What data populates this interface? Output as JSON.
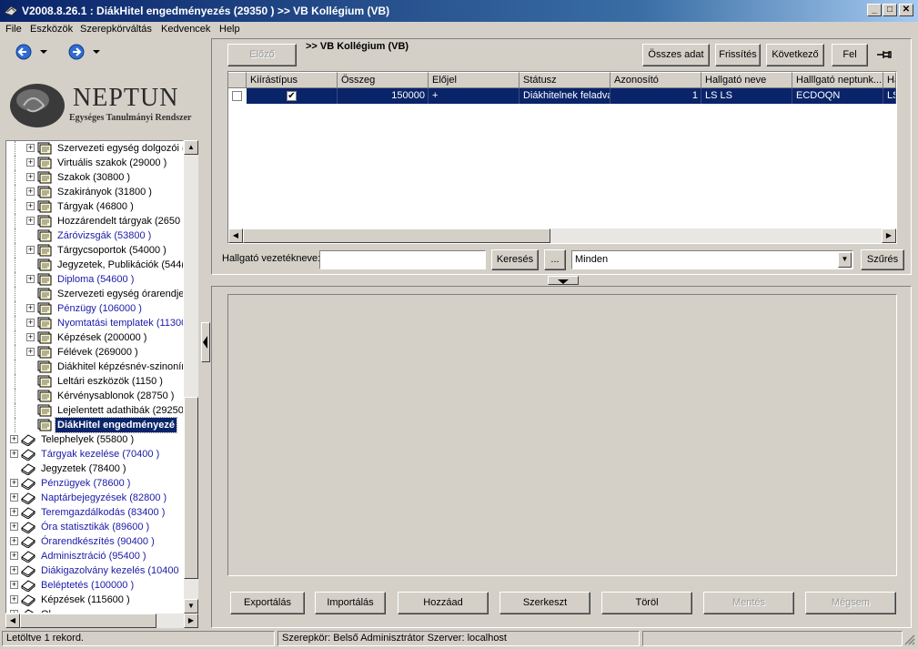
{
  "window": {
    "title": "V2008.8.26.1 : DiákHitel engedményezés (29350  )  >> VB Kollégium (VB)"
  },
  "menu": [
    "File",
    "Eszközök",
    "Szerepkörváltás",
    "Kedvencek",
    "Help"
  ],
  "logo": {
    "name": "NEPTUN",
    "subtitle": "Egységes Tanulmányi Rendszer"
  },
  "tree": [
    {
      "label": "Szervezeti egység dolgozói (",
      "blue": false,
      "level": 2,
      "exp": true
    },
    {
      "label": "Virtuális szakok (29000  )",
      "blue": false,
      "level": 2,
      "exp": true
    },
    {
      "label": "Szakok (30800  )",
      "blue": false,
      "level": 2,
      "exp": true
    },
    {
      "label": "Szakirányok (31800  )",
      "blue": false,
      "level": 2,
      "exp": true
    },
    {
      "label": "Tárgyak (46800  )",
      "blue": false,
      "level": 2,
      "exp": true
    },
    {
      "label": "Hozzárendelt tárgyak (2650",
      "blue": false,
      "level": 2,
      "exp": true
    },
    {
      "label": "Záróvizsgák (53800  )",
      "blue": true,
      "level": 2,
      "exp": false
    },
    {
      "label": "Tárgycsoportok (54000  )",
      "blue": false,
      "level": 2,
      "exp": true
    },
    {
      "label": "Jegyzetek, Publikációk (544(",
      "blue": false,
      "level": 2,
      "exp": false
    },
    {
      "label": "Diploma (54600  )",
      "blue": true,
      "level": 2,
      "exp": true
    },
    {
      "label": "Szervezeti egység órarendje",
      "blue": false,
      "level": 2,
      "exp": false
    },
    {
      "label": "Pénzügy (106000  )",
      "blue": true,
      "level": 2,
      "exp": true
    },
    {
      "label": "Nyomtatási templatek (11300",
      "blue": true,
      "level": 2,
      "exp": true
    },
    {
      "label": "Képzések (200000  )",
      "blue": false,
      "level": 2,
      "exp": true
    },
    {
      "label": "Félévek (269000  )",
      "blue": false,
      "level": 2,
      "exp": true
    },
    {
      "label": "Diákhitel képzésnév-szinoním",
      "blue": false,
      "level": 2,
      "exp": false
    },
    {
      "label": "Leltári eszközök (1150  )",
      "blue": false,
      "level": 2,
      "exp": false
    },
    {
      "label": "Kérvénysablonok (28750  )",
      "blue": false,
      "level": 2,
      "exp": false
    },
    {
      "label": "Lejelentett adathibák (29250",
      "blue": false,
      "level": 2,
      "exp": false
    },
    {
      "label": "DiákHitel engedményezé",
      "blue": false,
      "level": 2,
      "exp": false,
      "selected": true
    },
    {
      "label": "Telephelyek (55800  )",
      "blue": false,
      "level": 1,
      "exp": true
    },
    {
      "label": "Tárgyak kezelése (70400  )",
      "blue": true,
      "level": 1,
      "exp": true
    },
    {
      "label": "Jegyzetek (78400  )",
      "blue": false,
      "level": 1,
      "exp": false
    },
    {
      "label": "Pénzügyek (78600  )",
      "blue": true,
      "level": 1,
      "exp": true
    },
    {
      "label": "Naptárbejegyzések (82800  )",
      "blue": true,
      "level": 1,
      "exp": true
    },
    {
      "label": "Teremgazdálkodás (83400  )",
      "blue": true,
      "level": 1,
      "exp": true
    },
    {
      "label": "Óra statisztikák (89600  )",
      "blue": true,
      "level": 1,
      "exp": true
    },
    {
      "label": "Órarendkészítés (90400  )",
      "blue": true,
      "level": 1,
      "exp": true
    },
    {
      "label": "Adminisztráció (95400  )",
      "blue": true,
      "level": 1,
      "exp": true
    },
    {
      "label": "Diákigazolvány kezelés (10400",
      "blue": true,
      "level": 1,
      "exp": true
    },
    {
      "label": "Beléptetés (100000  )",
      "blue": true,
      "level": 1,
      "exp": true
    },
    {
      "label": "Képzések (115600  )",
      "blue": false,
      "level": 1,
      "exp": true
    },
    {
      "label": "Ol...",
      "blue": false,
      "level": 1,
      "exp": true
    }
  ],
  "toolbar": {
    "prev": "Előző",
    "breadcrumb": ">> VB Kollégium (VB)",
    "all_data": "Összes adat",
    "refresh": "Frissítés",
    "next": "Következő",
    "up": "Fel"
  },
  "grid": {
    "columns": [
      "Kiírástípus",
      "Összeg",
      "Előjel",
      "Státusz",
      "Azonosító",
      "Hallgató neve",
      "Halllgató neptunk...",
      "Ha"
    ],
    "rows": [
      {
        "kiirastipus_checked": true,
        "osszeg": "150000",
        "elojel": "+",
        "statusz": "Diákhitelnek feladva",
        "azonosito": "1",
        "hallgato_neve": "LS LS",
        "neptunkod": "ECDOQN",
        "ha": "LS"
      }
    ]
  },
  "search": {
    "label": "Hallgató vezetékneve:",
    "value": "",
    "search_button": "Keresés",
    "more_button": "...",
    "filter_value": "Minden",
    "filter_button": "Szűrés"
  },
  "actions": {
    "export": "Exportálás",
    "import": "Importálás",
    "add": "Hozzáad",
    "edit": "Szerkeszt",
    "delete": "Töröl",
    "save": "Mentés",
    "cancel": "Mégsem"
  },
  "statusbar": {
    "left": "Letöltve 1 rekord.",
    "role": "Szerepkör: Belső Adminisztrátor  Szerver: localhost"
  }
}
